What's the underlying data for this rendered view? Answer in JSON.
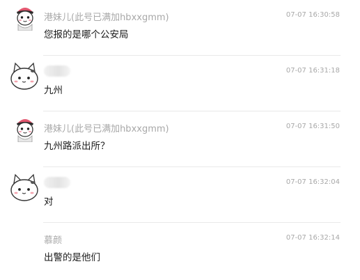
{
  "messages": [
    {
      "sender": "港妹儿(此号已满加hbxxgmm)",
      "avatar": "girl-avatar-icon",
      "time": "07-07 16:30:58",
      "text": "您报的是哪个公安局"
    },
    {
      "sender": "",
      "avatar": "cat-avatar-icon",
      "time": "07-07 16:31:18",
      "text": "九州"
    },
    {
      "sender": "港妹儿(此号已满加hbxxgmm)",
      "avatar": "girl-avatar-icon",
      "time": "07-07 16:31:50",
      "text": "九州路派出所？"
    },
    {
      "sender": "",
      "avatar": "cat-avatar-icon",
      "time": "07-07 16:32:04",
      "text": "对"
    },
    {
      "sender": "慕颜",
      "avatar": "",
      "time": "07-07 16:32:14",
      "text": "出警的是他们"
    }
  ]
}
